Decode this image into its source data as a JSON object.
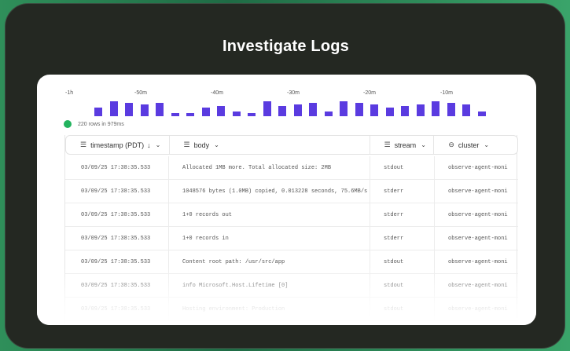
{
  "title": "Investigate Logs",
  "chart_data": {
    "type": "bar",
    "tick_labels": [
      "-1h",
      "-50m",
      "-40m",
      "-30m",
      "-20m",
      "-10m"
    ],
    "values": [
      5,
      9,
      8,
      7,
      8,
      2,
      2,
      5,
      6,
      3,
      2,
      9,
      6,
      7,
      8,
      3,
      9,
      8,
      7,
      5,
      6,
      7,
      9,
      8,
      7,
      3
    ],
    "color": "#5a3be0"
  },
  "rows_info": "220 rows in 979ms",
  "columns": [
    {
      "label": "timestamp (PDT)",
      "sort": "↓",
      "icon": "text-lines-icon"
    },
    {
      "label": "body",
      "icon": "text-lines-icon"
    },
    {
      "label": "stream",
      "icon": "text-lines-icon"
    },
    {
      "label": "cluster",
      "icon": "link-icon"
    }
  ],
  "rows": [
    {
      "timestamp": "03/09/25 17:38:35.533",
      "body": "Allocated 1MB more. Total allocated size: 2MB",
      "stream": "stdout",
      "cluster": "observe-agent-moni"
    },
    {
      "timestamp": "03/09/25 17:38:35.533",
      "body": "1048576 bytes (1.0MB) copied, 0.013228 seconds, 75.6MB/s",
      "stream": "stderr",
      "cluster": "observe-agent-moni"
    },
    {
      "timestamp": "03/09/25 17:38:35.533",
      "body": "1+0 records out",
      "stream": "stderr",
      "cluster": "observe-agent-moni"
    },
    {
      "timestamp": "03/09/25 17:38:35.533",
      "body": "1+0 records in",
      "stream": "stderr",
      "cluster": "observe-agent-moni"
    },
    {
      "timestamp": "03/09/25 17:38:35.533",
      "body": "Content root path: /usr/src/app",
      "stream": "stdout",
      "cluster": "observe-agent-moni"
    },
    {
      "timestamp": "03/09/25 17:38:35.533",
      "body": "info Microsoft.Host.Lifetime [0]",
      "stream": "stdout",
      "cluster": "observe-agent-moni"
    },
    {
      "timestamp": "03/09/25 17:38:35.533",
      "body": "Hosting environment: Production",
      "stream": "stdout",
      "cluster": "observe-agent-moni"
    }
  ]
}
